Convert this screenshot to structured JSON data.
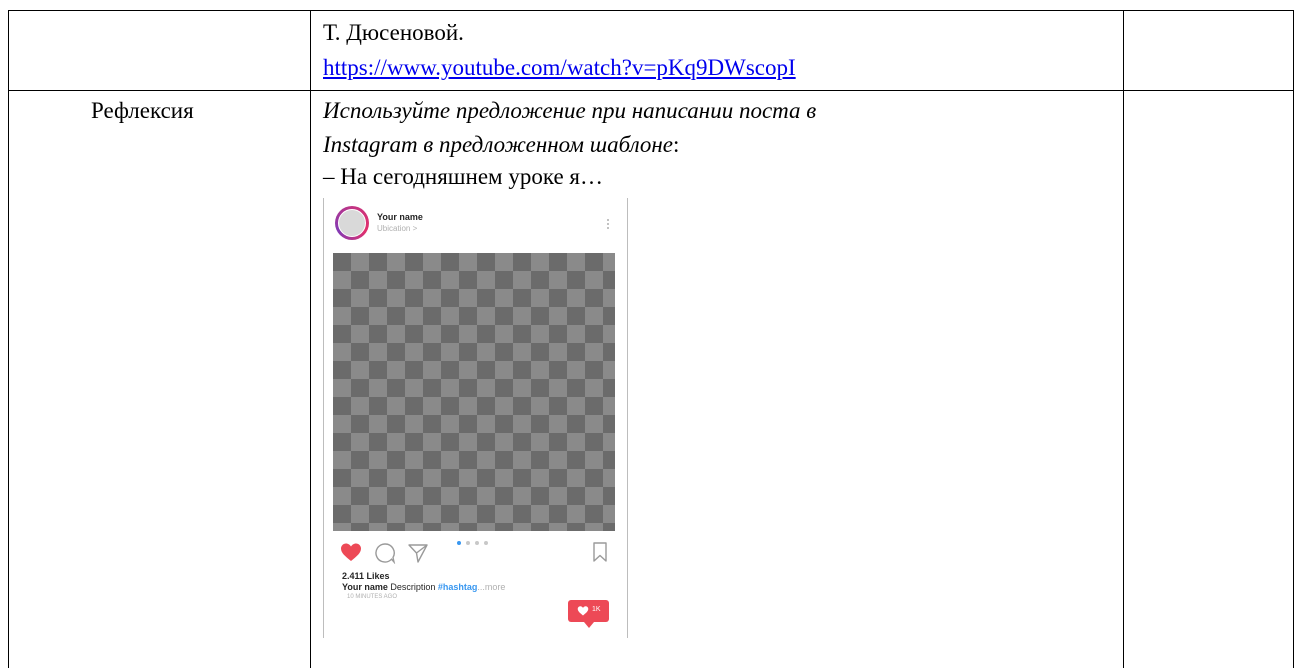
{
  "table": {
    "row1": {
      "text": "Т. Дюсеновой.",
      "link": "https://www.youtube.com/watch?v=pKq9DWscopI"
    },
    "row2": {
      "label": "Рефлексия",
      "instruction_line1": "Используйте предложение при написании поста в",
      "instruction_line2_italic": "Instagram в предложенном шаблоне",
      "instruction_line2_tail": ":",
      "prompt": "– На сегодняшнем уроке я…"
    }
  },
  "instagram_template": {
    "username": "Your name",
    "location": "Ubication >",
    "likes": "2.411 Likes",
    "caption_user": "Your name",
    "caption_text": "Description",
    "caption_tag": "#hashtag",
    "caption_more": "...more",
    "timestamp": "10 MINUTES AGO",
    "notification_count": "1K",
    "colors": {
      "heart": "#ed4956",
      "hashtag": "#3897f0",
      "ring": "#c13584"
    },
    "icons": [
      "heart-icon",
      "comment-icon",
      "share-icon",
      "bookmark-icon",
      "more-options-icon",
      "carousel-dots-icon"
    ]
  }
}
